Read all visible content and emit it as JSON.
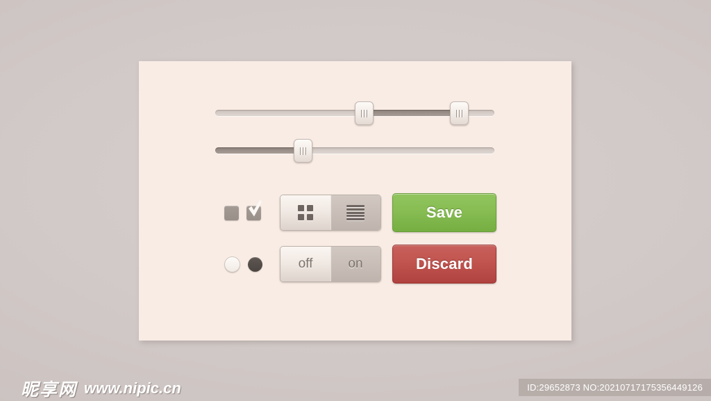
{
  "background": {
    "color": "#d1c9c7"
  },
  "card": {
    "color": "#f8ece5"
  },
  "sliders": [
    {
      "name": "range-slider",
      "type": "range",
      "track_color": "#d7cec9",
      "fill_color": "#9d928b",
      "fill_start_percent": 53,
      "fill_end_percent": 87,
      "handles": [
        {
          "label": "lower-handle",
          "position_percent": 53,
          "grip": "iii"
        },
        {
          "label": "upper-handle",
          "position_percent": 87,
          "grip": "iii"
        }
      ]
    },
    {
      "name": "value-slider",
      "type": "single",
      "track_color": "#d7cec9",
      "fill_color": "#9d928b",
      "fill_start_percent": 0,
      "fill_end_percent": 31,
      "handles": [
        {
          "label": "value-handle",
          "position_percent": 31,
          "grip": "iii"
        }
      ]
    }
  ],
  "row_top": {
    "checkbox_unchecked": {
      "name": "checkbox-unchecked",
      "checked": false
    },
    "checkbox_checked": {
      "name": "checkbox-checked",
      "checked": true
    },
    "segmented": {
      "name": "view-mode-switch",
      "options": [
        {
          "label": "",
          "icon": "grid-icon",
          "selected": true
        },
        {
          "label": "",
          "icon": "list-icon",
          "selected": false
        }
      ]
    },
    "button": {
      "label": "Save",
      "color": "#87bd53"
    }
  },
  "row_bottom": {
    "radio_empty": {
      "name": "radio-unselected",
      "selected": false
    },
    "radio_filled": {
      "name": "radio-selected",
      "selected": true
    },
    "segmented": {
      "name": "on-off-switch",
      "options": [
        {
          "label": "off",
          "selected": true
        },
        {
          "label": "on",
          "selected": false
        }
      ]
    },
    "button": {
      "label": "Discard",
      "color": "#c1544f"
    }
  },
  "watermark": {
    "logo": "昵享网",
    "url": "www.nipic.cn",
    "id_badge": "ID:29652873 NO:20210717175356449126"
  }
}
